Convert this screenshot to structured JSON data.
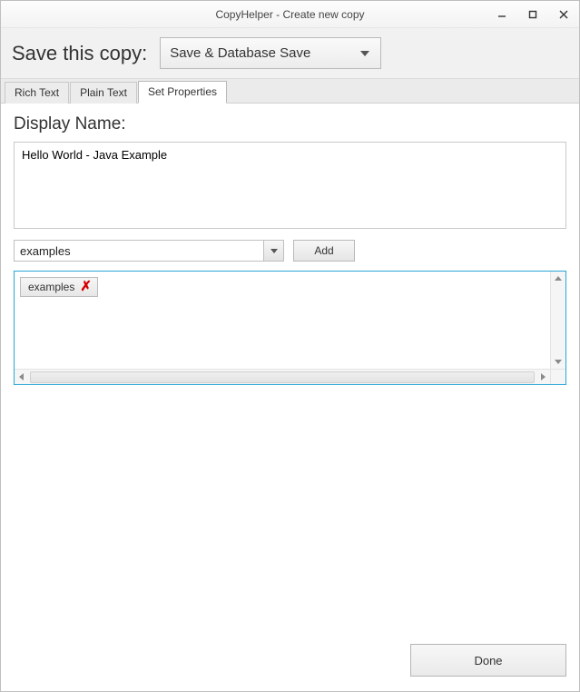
{
  "window": {
    "title": "CopyHelper - Create new copy"
  },
  "header": {
    "save_label": "Save this copy:",
    "save_mode": "Save & Database Save"
  },
  "tabs": {
    "rich_text": "Rich Text",
    "plain_text": "Plain Text",
    "set_properties": "Set Properties",
    "active": "set_properties"
  },
  "properties": {
    "display_name_label": "Display Name:",
    "display_name_value": "Hello World - Java Example",
    "category_combo_value": "examples",
    "add_button_label": "Add",
    "tags": [
      {
        "label": "examples"
      }
    ]
  },
  "footer": {
    "done_label": "Done"
  }
}
